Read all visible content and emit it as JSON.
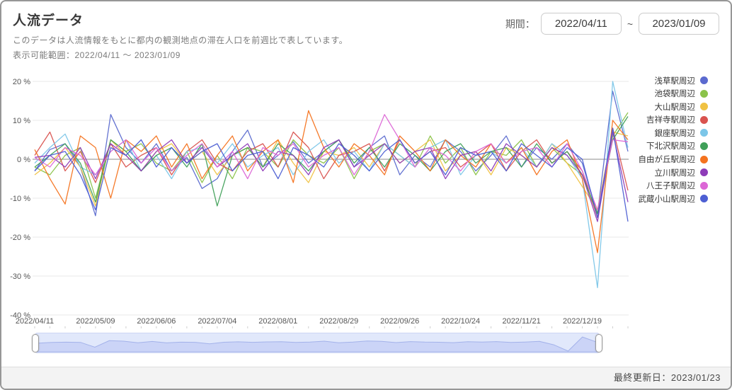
{
  "header": {
    "title": "人流データ",
    "subtitle": "このデータは人流情報をもとに都内の観測地点の滞在人口を前週比で表しています。",
    "available_range": "表示可能範囲：2022/04/11 ～ 2023/01/09"
  },
  "period": {
    "label": "期間：",
    "start_value": "2022/04/11",
    "separator": "~",
    "end_value": "2023/01/09"
  },
  "footer": {
    "last_updated": "最終更新日：2023/01/23"
  },
  "colors": {
    "grid": "#e8e8e8",
    "zero_line": "#8b8b8b",
    "axis_text": "#555555",
    "slider_fill": "#c3cef5",
    "slider_line": "#a3b2ea"
  },
  "chart_data": {
    "type": "line",
    "title": "人流データ（前週比）",
    "xlabel": "",
    "ylabel": "",
    "ylim": [
      -40,
      20
    ],
    "y_ticks": [
      20,
      10,
      0,
      -10,
      -20,
      -30,
      -40
    ],
    "y_tick_suffix": " %",
    "grid": "horizontal",
    "legend_position": "right",
    "x": [
      "2022/04/11",
      "2022/04/18",
      "2022/04/25",
      "2022/05/02",
      "2022/05/09",
      "2022/05/16",
      "2022/05/23",
      "2022/05/30",
      "2022/06/06",
      "2022/06/13",
      "2022/06/20",
      "2022/06/27",
      "2022/07/04",
      "2022/07/11",
      "2022/07/18",
      "2022/07/25",
      "2022/08/01",
      "2022/08/08",
      "2022/08/15",
      "2022/08/22",
      "2022/08/29",
      "2022/09/05",
      "2022/09/12",
      "2022/09/19",
      "2022/09/26",
      "2022/10/03",
      "2022/10/10",
      "2022/10/17",
      "2022/10/24",
      "2022/10/31",
      "2022/11/07",
      "2022/11/14",
      "2022/11/21",
      "2022/11/28",
      "2022/12/05",
      "2022/12/12",
      "2022/12/19",
      "2022/12/26",
      "2023/01/02",
      "2023/01/09"
    ],
    "x_tick_every": 4,
    "x_tick_labels": [
      "2022/04/11",
      "2022/05/09",
      "2022/06/06",
      "2022/07/04",
      "2022/08/01",
      "2022/08/29",
      "2022/09/26",
      "2022/10/24",
      "2022/11/21",
      "2022/12/19"
    ],
    "series": [
      {
        "key": "asakusa",
        "name": "浅草駅周辺",
        "color": "#5b6acf",
        "values": [
          -3,
          2.5,
          4,
          -2,
          -14.5,
          11.5,
          3,
          -1,
          4,
          -3,
          0.5,
          -7.5,
          -5,
          2,
          7.5,
          -2,
          1,
          4.5,
          -1,
          2,
          5,
          -2,
          3,
          6,
          -4,
          1,
          -2,
          5,
          2,
          -3,
          1,
          6,
          -2,
          3,
          0,
          4,
          -1,
          -14,
          17.5,
          2
        ]
      },
      {
        "key": "ikebukuro",
        "name": "池袋駅周辺",
        "color": "#8bc34a",
        "values": [
          -2,
          -4,
          1,
          3,
          -10,
          5,
          2,
          4,
          -1,
          -3,
          2,
          -6,
          1,
          -5,
          3,
          2,
          -2,
          5,
          1,
          -1,
          3,
          -5,
          2,
          4,
          1,
          -2,
          6,
          -1,
          3,
          -4,
          2,
          1,
          5,
          -2,
          3,
          -1,
          -4,
          -14,
          6,
          12
        ]
      },
      {
        "key": "oyama",
        "name": "大山駅周辺",
        "color": "#f0c243",
        "values": [
          -4,
          -1,
          3,
          -2,
          -12,
          5,
          1,
          -3,
          2,
          4,
          -1,
          2,
          -4,
          1,
          3,
          -2,
          5,
          -1,
          -6,
          2,
          1,
          3,
          -2,
          4,
          -1,
          2,
          5,
          -3,
          1,
          2,
          -4,
          3,
          1,
          -2,
          4,
          -1,
          -7,
          -13,
          7,
          6
        ]
      },
      {
        "key": "kichijoji",
        "name": "吉祥寺駅周辺",
        "color": "#d9534f",
        "values": [
          1,
          7,
          -3,
          2,
          -6,
          4,
          -2,
          1,
          3,
          -4,
          2,
          5,
          -1,
          -3,
          2,
          4,
          -2,
          7,
          3,
          -5,
          1,
          2,
          4,
          -3,
          5,
          -1,
          2,
          3,
          -2,
          1,
          4,
          -3,
          2,
          5,
          -1,
          2,
          -3,
          -15,
          8,
          -8
        ]
      },
      {
        "key": "ginza",
        "name": "銀座駅周辺",
        "color": "#7cc6e8",
        "values": [
          -1,
          3,
          6.5,
          -2,
          -4,
          2,
          5,
          -3,
          1,
          -5,
          2,
          3,
          -1,
          4,
          -2,
          1,
          3,
          -4,
          2,
          5,
          -1,
          2,
          -3,
          4,
          1,
          -2,
          3,
          5,
          -4,
          1,
          2,
          -1,
          3,
          -2,
          4,
          1,
          -5,
          -33,
          20,
          3
        ]
      },
      {
        "key": "shimokitazawa",
        "name": "下北沢駅周辺",
        "color": "#40a059",
        "values": [
          -2,
          1,
          4,
          -1,
          -11,
          5,
          2,
          -3,
          1,
          3,
          -2,
          4,
          -12,
          1,
          3,
          -2,
          4,
          1,
          -3,
          2,
          5,
          -1,
          3,
          -2,
          4,
          1,
          -3,
          2,
          4,
          -1,
          2,
          3,
          -2,
          4,
          -1,
          2,
          -4,
          -14,
          5,
          11
        ]
      },
      {
        "key": "jiyugaoka",
        "name": "自由が丘駅周辺",
        "color": "#f4731f",
        "values": [
          2.5,
          -5,
          -11.5,
          6,
          3,
          -10,
          5,
          2,
          6,
          -2,
          4,
          -5,
          1,
          6,
          -3,
          2,
          5,
          -6,
          12.5,
          3,
          -2,
          4,
          1,
          -4,
          6,
          2,
          -3,
          5,
          1,
          -2,
          4,
          -1,
          3,
          -4,
          2,
          5,
          -5,
          -24,
          10,
          5
        ]
      },
      {
        "key": "tachikawa",
        "name": "立川駅周辺",
        "color": "#8e3cb8",
        "values": [
          0.5,
          1,
          -2,
          3,
          -5,
          4,
          1,
          -3,
          2,
          5,
          -1,
          3,
          -2,
          1,
          4,
          -3,
          2,
          1,
          -4,
          3,
          5,
          -2,
          1,
          4,
          -1,
          2,
          3,
          -5,
          1,
          2,
          -3,
          4,
          1,
          -2,
          3,
          1,
          -4,
          -16,
          7,
          -11
        ]
      },
      {
        "key": "hachioji",
        "name": "八王子駅周辺",
        "color": "#dc67d6",
        "values": [
          0.5,
          -2,
          3,
          1,
          -4,
          2,
          5,
          -1,
          3,
          -3,
          1,
          4,
          -2,
          2,
          -5,
          3,
          1,
          4,
          -2,
          1,
          3,
          -4,
          2,
          11.5,
          5,
          -2,
          3,
          1,
          -3,
          2,
          4,
          -1,
          2,
          3,
          -2,
          4,
          -3,
          -13,
          5,
          4.5
        ]
      },
      {
        "key": "musashikoyama",
        "name": "武蔵小山駅周辺",
        "color": "#4d5fd3",
        "values": [
          -3,
          1,
          2,
          -4,
          -13,
          3,
          1,
          5,
          -2,
          3,
          -1,
          2,
          4,
          -3,
          1,
          2,
          -5,
          3,
          1,
          -2,
          4,
          1,
          -3,
          2,
          5,
          -1,
          2,
          -4,
          3,
          1,
          2,
          -3,
          4,
          1,
          -2,
          3,
          0,
          -15,
          8,
          -16
        ]
      }
    ]
  }
}
